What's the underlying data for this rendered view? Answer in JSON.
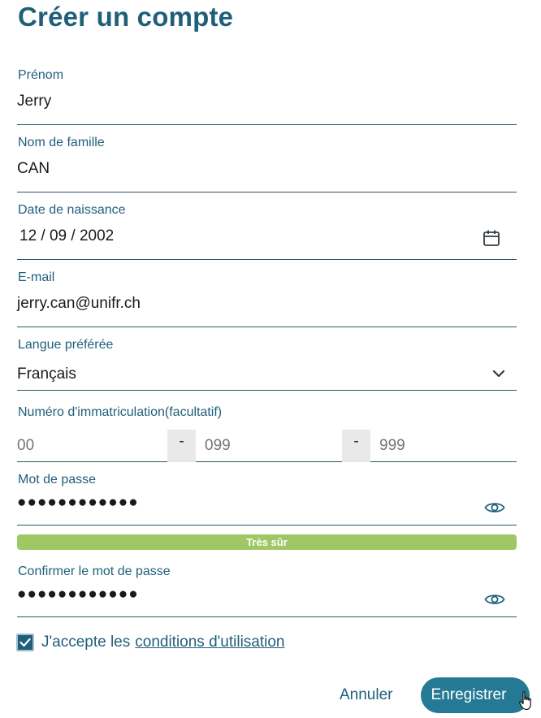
{
  "page": {
    "title": "Créer un compte"
  },
  "form": {
    "first_name": {
      "label": "Prénom",
      "value": "Jerry"
    },
    "last_name": {
      "label": "Nom de famille",
      "value": "CAN"
    },
    "birth_date": {
      "label": "Date de naissance",
      "value": "12 / 09 / 2002"
    },
    "email": {
      "label": "E-mail",
      "value": "jerry.can@unifr.ch"
    },
    "language": {
      "label": "Langue préférée",
      "value": "Français"
    },
    "matriculation": {
      "label": "Numéro d'immatriculation(facultatif)",
      "part1_placeholder": "00",
      "part2_placeholder": "099",
      "part3_placeholder": "999",
      "separator": "-"
    },
    "password": {
      "label": "Mot de passe",
      "value": "●●●●●●●●●●●●"
    },
    "strength": {
      "label": "Très sûr",
      "level": 1.0
    },
    "confirm_password": {
      "label": "Confirmer le mot de passe",
      "value": "●●●●●●●●●●●●"
    },
    "terms": {
      "checked": true,
      "text": "J'accepte les",
      "link": "conditions d'utilisation"
    }
  },
  "actions": {
    "cancel": "Annuler",
    "save": "Enregistrer"
  },
  "colors": {
    "primary": "#1f5f7a",
    "button": "#247a94",
    "strength": "#9fc865"
  }
}
